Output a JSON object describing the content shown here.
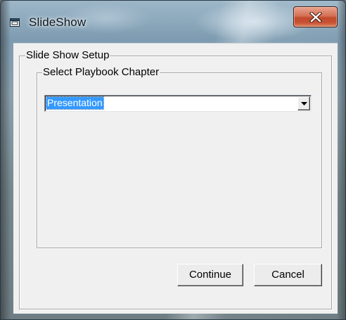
{
  "window": {
    "title": "SlideShow",
    "close_label": "Close"
  },
  "dialog": {
    "outer_group_label": "Slide Show Setup",
    "inner_group_label": "Select Playbook Chapter",
    "chapter_select": {
      "selected_value": "Presentation",
      "icon": "chevron-down-icon"
    },
    "continue_label": "Continue",
    "cancel_label": "Cancel"
  },
  "colors": {
    "selection": "#3399ff",
    "close_button": "#c75234",
    "dialog_background": "#f0f0f0"
  }
}
